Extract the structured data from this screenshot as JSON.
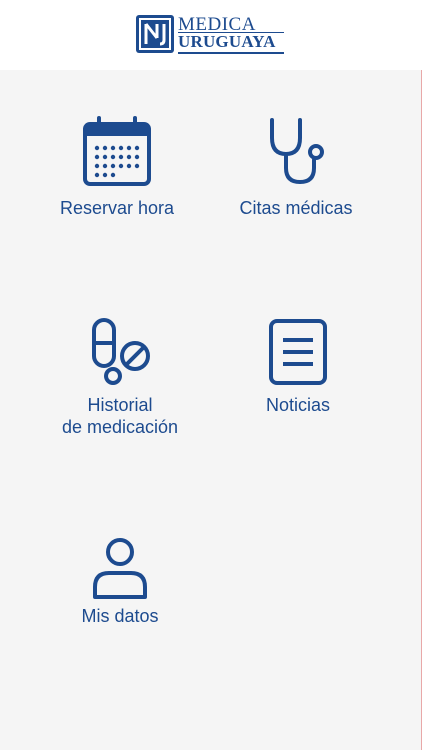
{
  "header": {
    "logo_line1": "MEDICA",
    "logo_line2": "URUGUAYA",
    "brand_color": "#1d4b8f"
  },
  "menu": [
    {
      "label": "Reservar hora",
      "icon": "calendar-icon"
    },
    {
      "label": "Citas médicas",
      "icon": "stethoscope-icon"
    },
    {
      "label": "Historial\nde medicación",
      "icon": "pills-icon"
    },
    {
      "label": "Noticias",
      "icon": "document-icon"
    },
    {
      "label": "Mis datos",
      "icon": "user-icon"
    }
  ]
}
